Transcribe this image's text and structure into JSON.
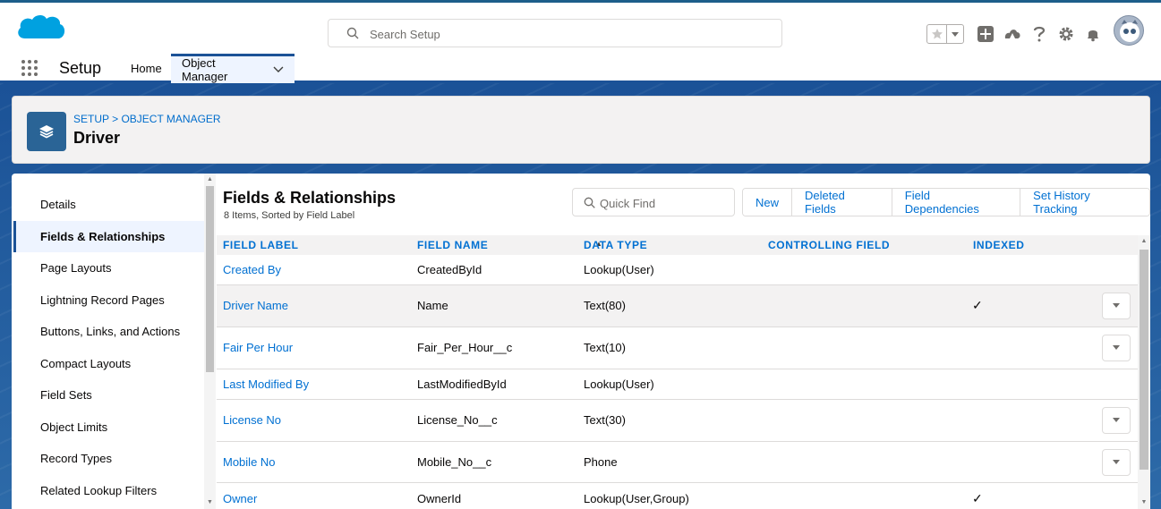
{
  "header": {
    "search_placeholder": "Search Setup",
    "icons": [
      "favorites-star-icon",
      "favorites-dropdown-icon",
      "global-actions-icon",
      "trailhead-icon",
      "help-icon",
      "setup-gear-icon",
      "notifications-bell-icon",
      "user-avatar"
    ]
  },
  "context": {
    "app_name": "Setup",
    "tabs": [
      {
        "label": "Home"
      },
      {
        "label": "Object Manager"
      }
    ]
  },
  "page_header": {
    "breadcrumb": "SETUP > OBJECT MANAGER",
    "title": "Driver"
  },
  "sidebar": {
    "items": [
      {
        "label": "Details"
      },
      {
        "label": "Fields & Relationships"
      },
      {
        "label": "Page Layouts"
      },
      {
        "label": "Lightning Record Pages"
      },
      {
        "label": "Buttons, Links, and Actions"
      },
      {
        "label": "Compact Layouts"
      },
      {
        "label": "Field Sets"
      },
      {
        "label": "Object Limits"
      },
      {
        "label": "Record Types"
      },
      {
        "label": "Related Lookup Filters"
      }
    ],
    "active_index": 1
  },
  "section": {
    "title": "Fields & Relationships",
    "subtitle": "8 Items, Sorted by Field Label",
    "quick_find_placeholder": "Quick Find",
    "buttons": [
      "New",
      "Deleted Fields",
      "Field Dependencies",
      "Set History Tracking"
    ]
  },
  "table": {
    "columns": [
      "FIELD LABEL",
      "FIELD NAME",
      "DATA TYPE",
      "CONTROLLING FIELD",
      "INDEXED"
    ],
    "rows": [
      {
        "label": "Created By",
        "name": "CreatedById",
        "type": "Lookup(User)",
        "controlling": "",
        "indexed": "",
        "menu": false
      },
      {
        "label": "Driver Name",
        "name": "Name",
        "type": "Text(80)",
        "controlling": "",
        "indexed": "✓",
        "menu": true
      },
      {
        "label": "Fair Per Hour",
        "name": "Fair_Per_Hour__c",
        "type": "Text(10)",
        "controlling": "",
        "indexed": "",
        "menu": true
      },
      {
        "label": "Last Modified By",
        "name": "LastModifiedById",
        "type": "Lookup(User)",
        "controlling": "",
        "indexed": "",
        "menu": false
      },
      {
        "label": "License No",
        "name": "License_No__c",
        "type": "Text(30)",
        "controlling": "",
        "indexed": "",
        "menu": true
      },
      {
        "label": "Mobile No",
        "name": "Mobile_No__c",
        "type": "Phone",
        "controlling": "",
        "indexed": "",
        "menu": true
      },
      {
        "label": "Owner",
        "name": "OwnerId",
        "type": "Lookup(User,Group)",
        "controlling": "",
        "indexed": "✓",
        "menu": false
      }
    ]
  },
  "colors": {
    "brand": "#1b5297",
    "link": "#0070d2",
    "logo": "#00a1e0"
  }
}
